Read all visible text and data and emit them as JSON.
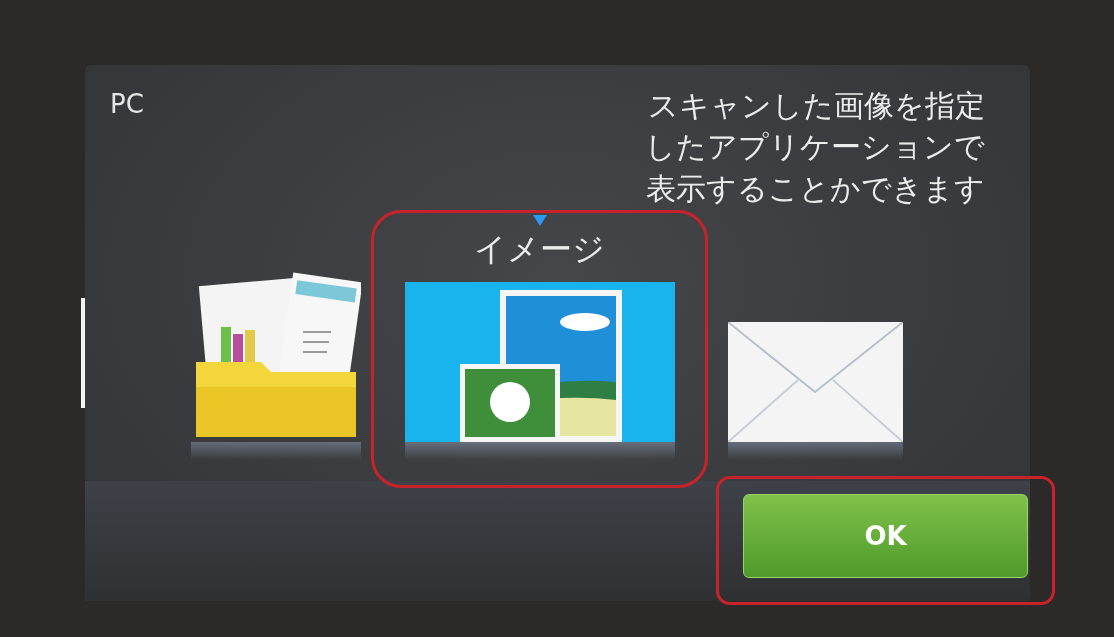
{
  "screen": {
    "title": "PC",
    "message_lines": [
      "スキャンした画像を指定",
      "したアプリケーションで",
      "表示することかできます"
    ]
  },
  "apps": [
    {
      "kind": "folder",
      "selected": false
    },
    {
      "kind": "image",
      "label": "イメージ",
      "selected": true
    },
    {
      "kind": "email",
      "selected": false
    }
  ],
  "ok_button": {
    "label": "OK"
  }
}
